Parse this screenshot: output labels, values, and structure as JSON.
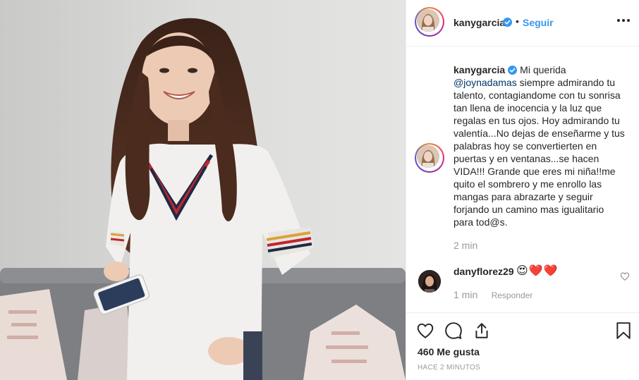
{
  "post": {
    "image_alt": "Mujer sonriente con suéter blanco sosteniendo un teléfono",
    "header": {
      "username": "kanygarcia",
      "separator": "•",
      "follow_label": "Seguir",
      "more_icon": "more-options-icon"
    },
    "caption": {
      "username": "kanygarcia",
      "intro": "Mi querida ",
      "mention": "@joynadamas",
      "text": " siempre admirando tu talento, contagiandome con tu sonrisa tan llena de inocencia y la luz que regalas en tus ojos. Hoy admirando tu valentía...No dejas de enseñarme y tus palabras hoy se convertierten en puertas y en ventanas...se hacen VIDA!!! Grande que eres mi niña!!me quito el sombrero y me enrollo las mangas para abrazarte y seguir forjando un camino mas igualitario para tod@s.",
      "time": "2 min"
    },
    "comments": [
      {
        "username": "danyflorez29",
        "text": "😍❤️❤️",
        "time": "1 min",
        "reply_label": "Responder"
      }
    ],
    "actions": {
      "like_icon": "heart-icon",
      "comment_icon": "comment-icon",
      "share_icon": "share-icon",
      "save_icon": "bookmark-icon"
    },
    "likes": "460 Me gusta",
    "posted_ago": "HACE 2 MINUTOS"
  },
  "colors": {
    "link_blue": "#3897f0",
    "mention_blue": "#003569",
    "muted_gray": "#999999",
    "text": "#262626"
  }
}
